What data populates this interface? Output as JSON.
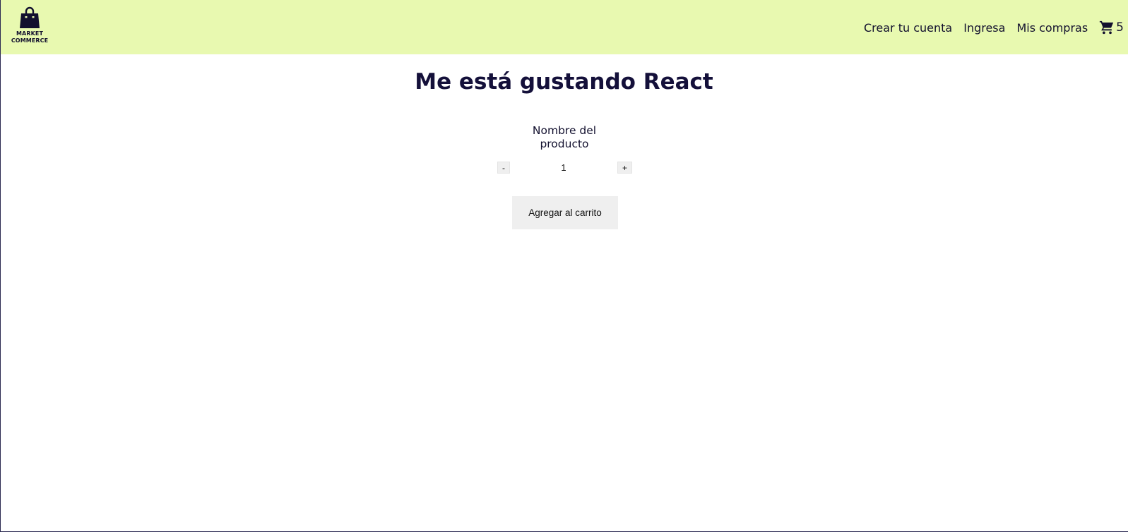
{
  "brand": {
    "line1": "MARKET",
    "line2": "COMMERCE",
    "icon": "shopping-bag-icon"
  },
  "nav": {
    "create_account": "Crear tu cuenta",
    "login": "Ingresa",
    "purchases": "Mis compras",
    "cart_icon": "cart-icon",
    "cart_count": "5"
  },
  "main": {
    "title": "Me está gustando React",
    "product_name": "Nombre del producto",
    "quantity": "1",
    "decrement_label": "-",
    "increment_label": "+",
    "add_to_cart_label": "Agregar al carrito"
  },
  "colors": {
    "header_bg": "#e8f9b0",
    "text_dark": "#12102e",
    "button_bg": "#efefef"
  }
}
